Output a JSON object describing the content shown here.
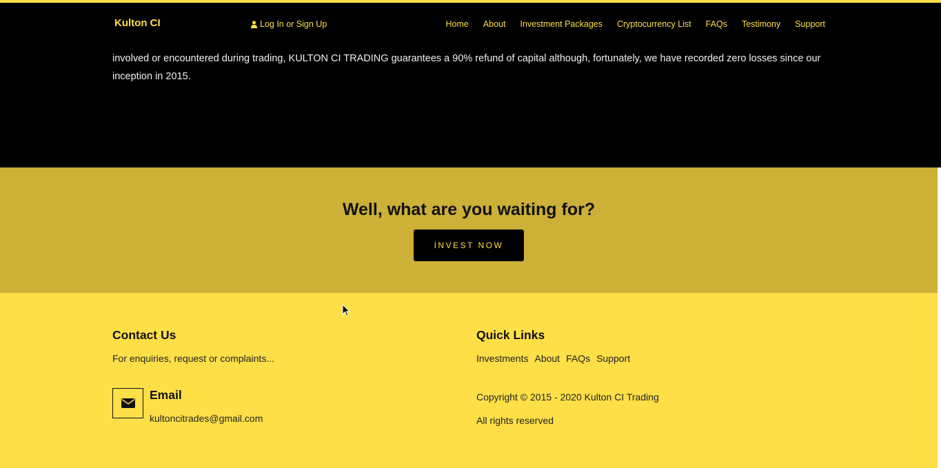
{
  "colors": {
    "accent": "#ffdf47",
    "cta_background": "#ccb038",
    "dark": "#000000"
  },
  "navbar": {
    "brand": "Kulton CI",
    "login": {
      "icon": "user-icon",
      "label": "Log In or Sign Up"
    },
    "links": [
      "Home",
      "About",
      "Investment Packages",
      "Cryptocurrency List",
      "FAQs",
      "Testimony",
      "Support"
    ]
  },
  "intro": {
    "text": "involved or encountered during trading, KULTON CI TRADING guarantees a 90% refund of capital although, fortunately, we have recorded zero losses since our inception in 2015."
  },
  "cta": {
    "heading": "Well, what are you waiting for?",
    "button_label": "INVEST NOW"
  },
  "footer": {
    "contact": {
      "title": "Contact Us",
      "subtitle": "For enquiries, request or complaints...",
      "email_icon": "envelope-icon",
      "email_title": "Email",
      "email_value": "kultoncitrades@gmail.com"
    },
    "quick_links": {
      "title": "Quick Links",
      "items": [
        "Investments",
        "About",
        "FAQs",
        "Support"
      ]
    },
    "copyright": "Copyright © 2015 - 2020 Kulton CI Trading",
    "rights": "All rights reserved"
  }
}
